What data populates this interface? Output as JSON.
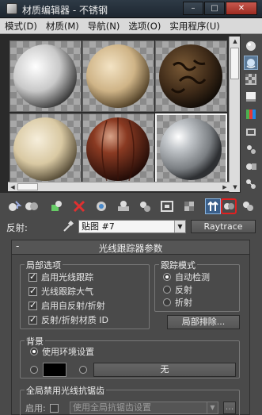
{
  "window": {
    "title": "材质编辑器 - 不锈钢",
    "minimize": "–",
    "restore": "□",
    "close": "✕"
  },
  "menu": [
    "模式(D)",
    "材质(M)",
    "导航(N)",
    "选项(O)",
    "实用程序(U)"
  ],
  "slots": [
    {
      "name": "slot-1",
      "material": "white-matte"
    },
    {
      "name": "slot-2",
      "material": "beige-plaster"
    },
    {
      "name": "slot-3",
      "material": "dark-pattern"
    },
    {
      "name": "slot-4",
      "material": "cream-stone"
    },
    {
      "name": "slot-5",
      "material": "red-wood"
    },
    {
      "name": "slot-6",
      "material": "chrome",
      "selected": true
    }
  ],
  "reflect": {
    "label": "反射:",
    "map": "贴图 #7",
    "map_type": "Raytrace"
  },
  "rollout": {
    "sign": "-",
    "title": "光线跟踪器参数",
    "local_options": {
      "title": "局部选项",
      "items": [
        {
          "label": "启用光线跟踪",
          "checked": true
        },
        {
          "label": "光线跟踪大气",
          "checked": true
        },
        {
          "label": "启用自反射/折射",
          "checked": true
        },
        {
          "label": "反射/折射材质 ID",
          "checked": true
        }
      ]
    },
    "trace_mode": {
      "title": "跟踪模式",
      "options": [
        "自动检测",
        "反射",
        "折射"
      ],
      "selected": 0
    },
    "local_exclude_button": "局部排除...",
    "background": {
      "title": "背景",
      "use_env": "使用环境设置",
      "none_label": "无"
    },
    "aa": {
      "title": "全局禁用光线抗锯齿",
      "enable_label": "启用:",
      "select_value": "使用全局抗锯齿设置",
      "more_button": "..."
    }
  },
  "colors": {
    "accent": "#3a5f8a",
    "highlight_box": "#e02020"
  }
}
